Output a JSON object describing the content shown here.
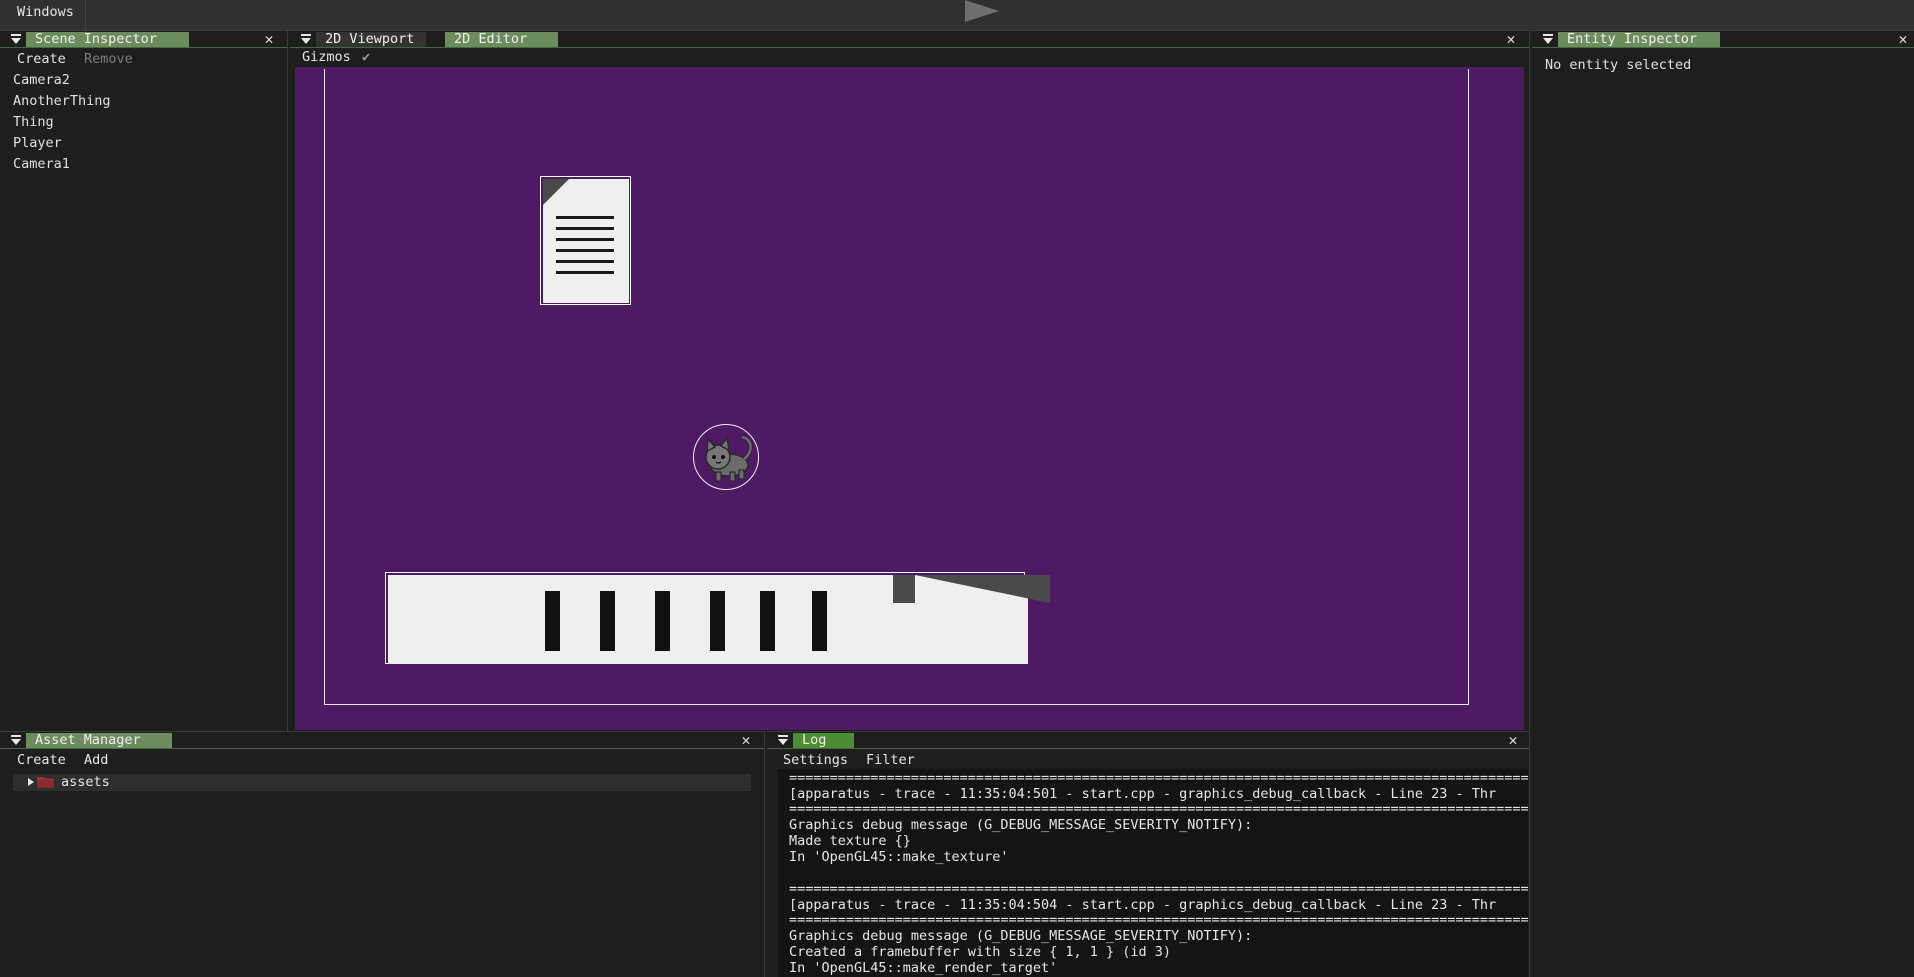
{
  "menubar": {
    "windows_label": "Windows"
  },
  "scene_inspector": {
    "title": "Scene Inspector",
    "create_label": "Create",
    "remove_label": "Remove",
    "entities": [
      "Camera2",
      "AnotherThing",
      "Thing",
      "Player",
      "Camera1"
    ]
  },
  "editor": {
    "tabs": [
      "2D Viewport",
      "2D Editor"
    ],
    "gizmos_label": "Gizmos",
    "gizmos_check": "✔",
    "viewport_color": "#4e1a63"
  },
  "entity_inspector": {
    "title": "Entity Inspector",
    "empty_message": "No entity selected"
  },
  "asset_manager": {
    "title": "Asset Manager",
    "create_label": "Create",
    "add_label": "Add",
    "root_folder": "assets"
  },
  "log": {
    "title": "Log",
    "settings_label": "Settings",
    "filter_label": "Filter",
    "lines": [
      "==================================================================================================================",
      "[apparatus - trace - 11:35:04:501 - start.cpp - graphics_debug_callback - Line 23 - Thr",
      "==================================================================================================================",
      "Graphics debug message (G_DEBUG_MESSAGE_SEVERITY_NOTIFY):",
      "Made texture {}",
      "In 'OpenGL45::make_texture'",
      "",
      "==================================================================================================================",
      "[apparatus - trace - 11:35:04:504 - start.cpp - graphics_debug_callback - Line 23 - Thr",
      "==================================================================================================================",
      "Graphics debug message (G_DEBUG_MESSAGE_SEVERITY_NOTIFY):",
      "Created a framebuffer with size { 1, 1 } (id 3)",
      "In 'OpenGL45::make_render_target'"
    ]
  }
}
